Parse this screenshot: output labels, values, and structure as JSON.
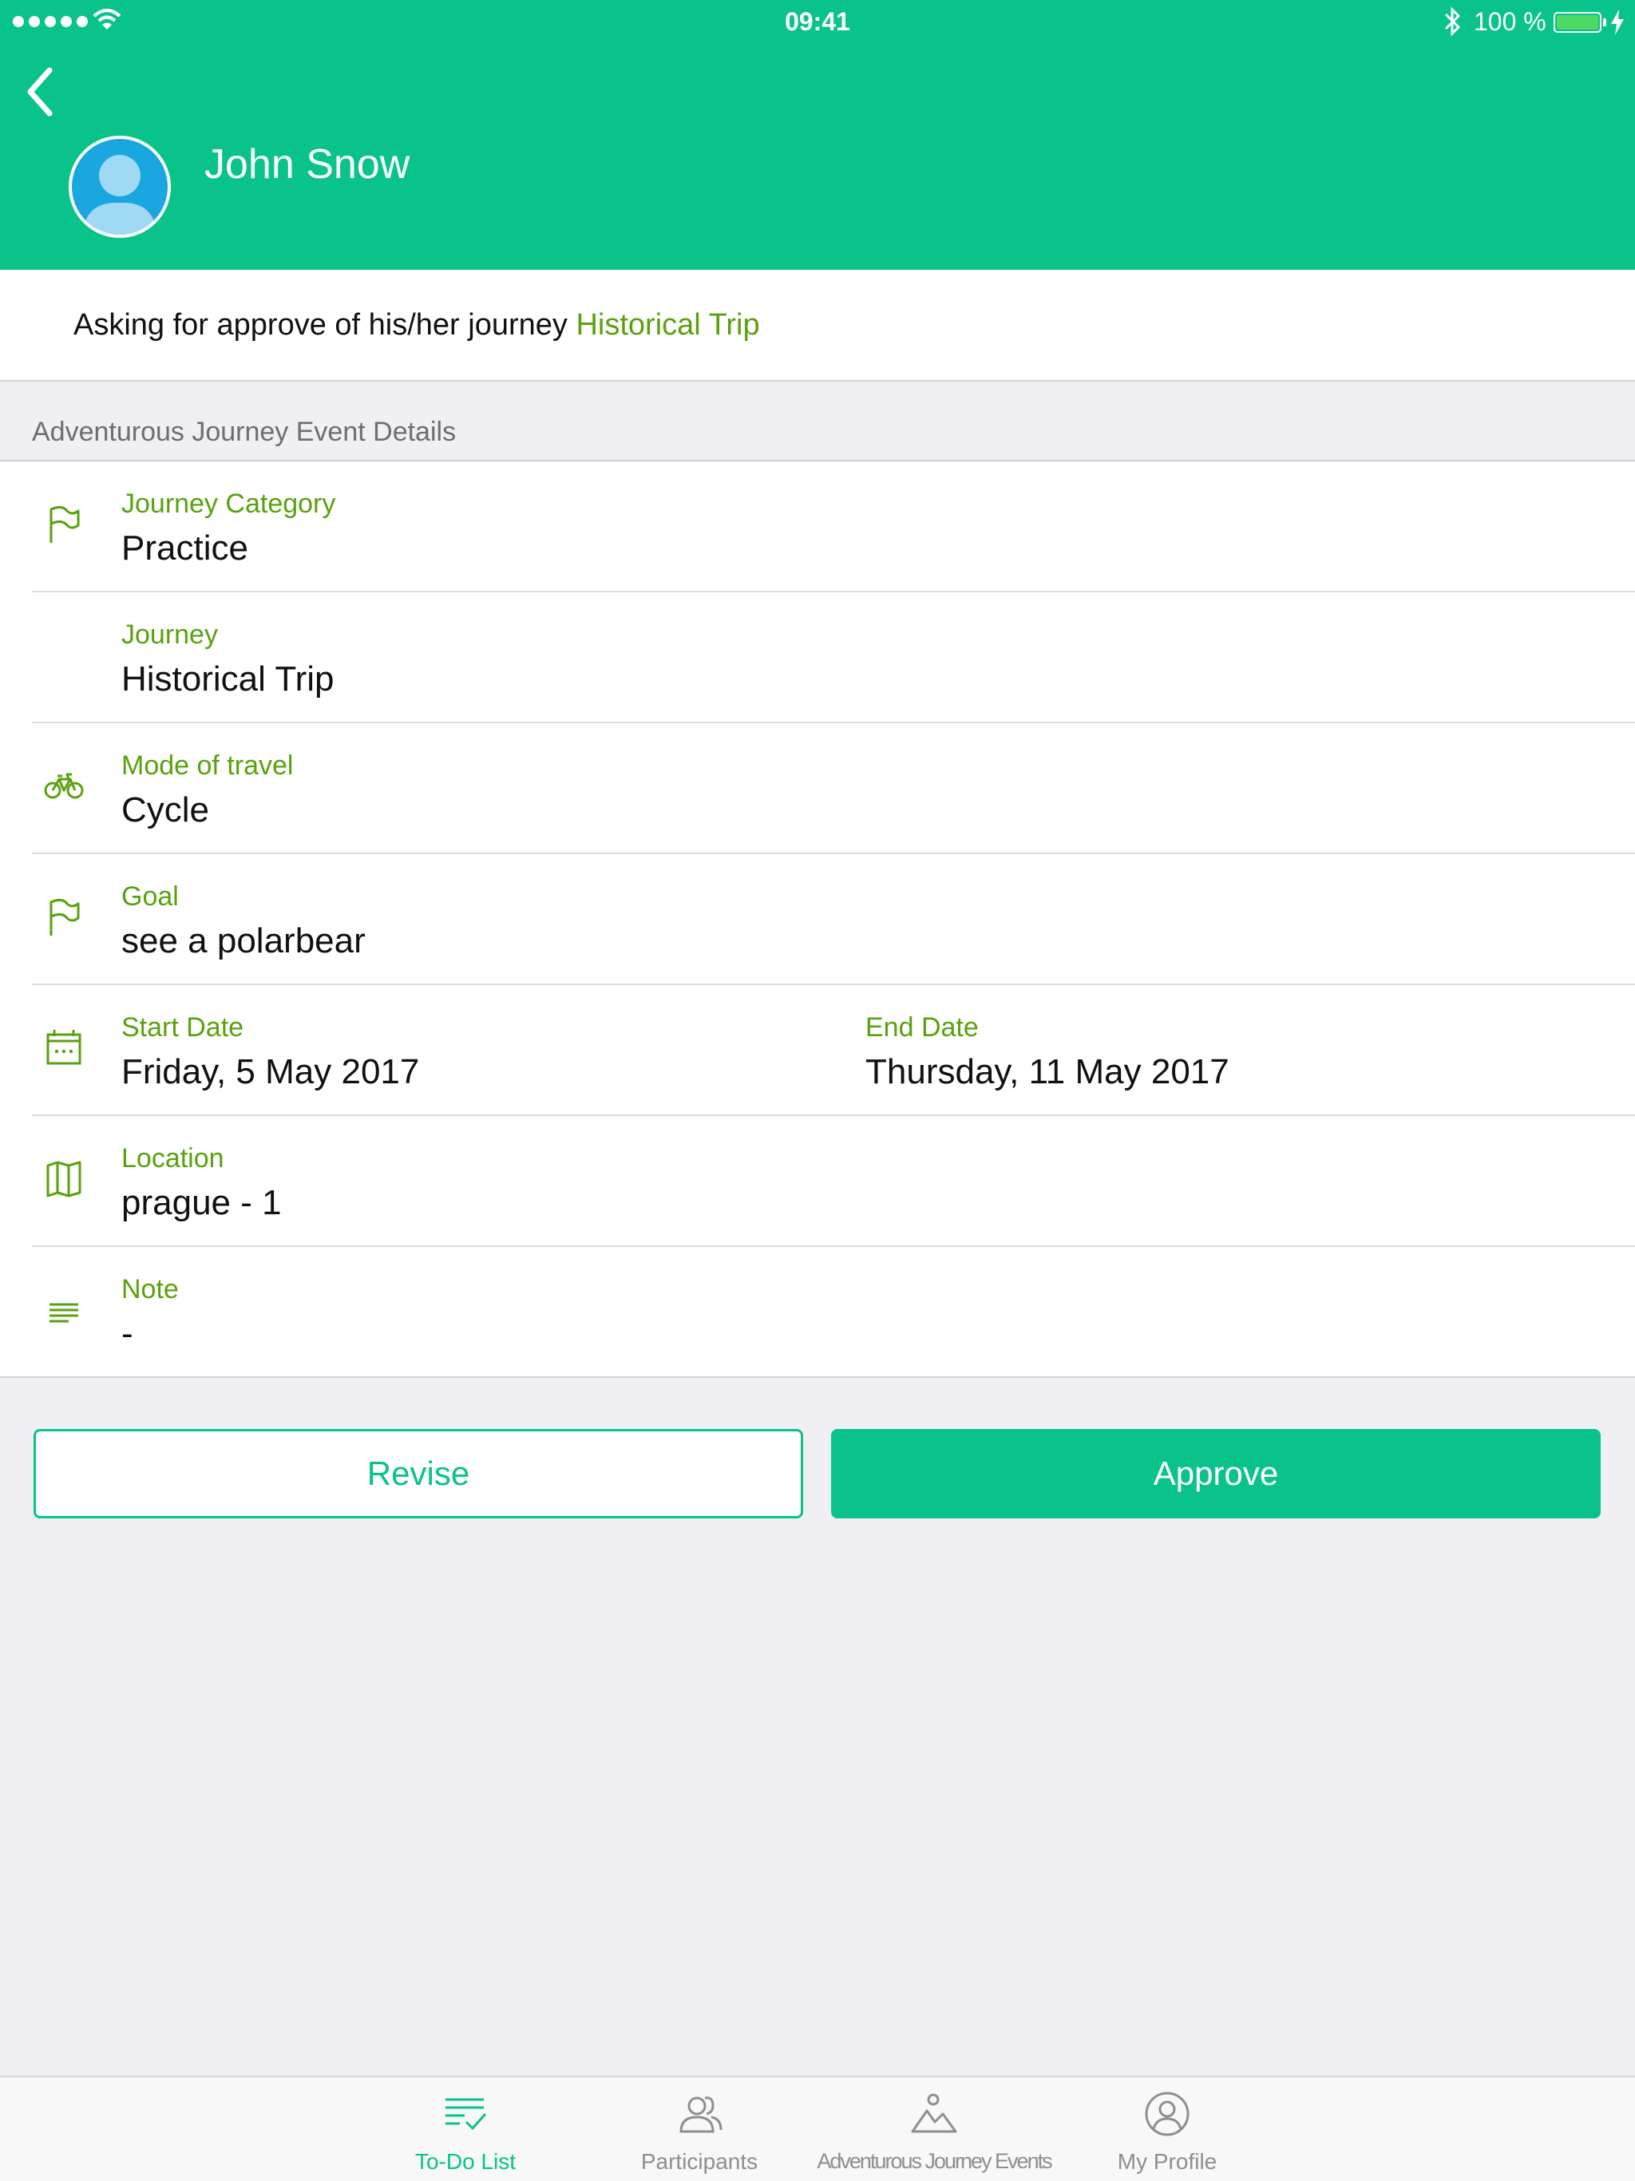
{
  "status_bar": {
    "time": "09:41",
    "battery": "100 %"
  },
  "header": {
    "user_name": "John Snow"
  },
  "request": {
    "text": "Asking for approve of his/her journey",
    "journey": "Historical Trip"
  },
  "section": {
    "title": "Adventurous Journey Event Details"
  },
  "details": {
    "journey_category": {
      "label": "Journey Category",
      "value": "Practice",
      "icon": "flag-icon"
    },
    "journey": {
      "label": "Journey",
      "value": "Historical Trip"
    },
    "mode_of_travel": {
      "label": "Mode of travel",
      "value": "Cycle",
      "icon": "bicycle-icon"
    },
    "goal": {
      "label": "Goal",
      "value": "see a polarbear",
      "icon": "flag-icon"
    },
    "start_date": {
      "label": "Start Date",
      "value": "Friday, 5 May 2017",
      "icon": "calendar-icon"
    },
    "end_date": {
      "label": "End Date",
      "value": "Thursday, 11 May 2017"
    },
    "location": {
      "label": "Location",
      "value": "prague - 1",
      "icon": "map-icon"
    },
    "note": {
      "label": "Note",
      "value": "-",
      "icon": "notes-icon"
    }
  },
  "actions": {
    "revise_label": "Revise",
    "approve_label": "Approve"
  },
  "tabbar": {
    "todo": "To-Do List",
    "participants": "Participants",
    "events": "Adventurous Journey Events",
    "profile": "My Profile"
  },
  "colors": {
    "brand": "#09c38b",
    "accent_text": "#5aa10e",
    "background": "#efeff4"
  }
}
